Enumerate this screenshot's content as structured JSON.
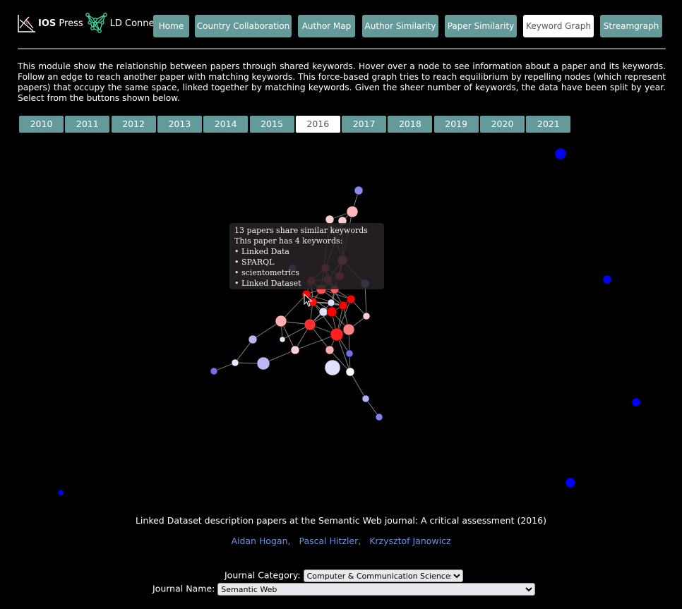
{
  "header": {
    "logo_ios": "IOS",
    "logo_press": " Press",
    "logo_ld": "LD Connect",
    "nav": [
      {
        "label": "Home",
        "active": false
      },
      {
        "label": "Country Collaboration",
        "active": false
      },
      {
        "label": "Author Map",
        "active": false
      },
      {
        "label": "Author Similarity",
        "active": false
      },
      {
        "label": "Paper Similarity",
        "active": false
      },
      {
        "label": "Keyword Graph",
        "active": true
      },
      {
        "label": "Streamgraph",
        "active": false
      }
    ]
  },
  "description": "This module show the relationship between papers through shared keywords. Hover over a node to see information about a paper and its keywords. Follow an edge to reach another paper with matching keywords. This force-based graph tries to reach equilibrium by repelling nodes (which represent papers) that occupy the same space, linked together by matching keywords. Given the sheer number of keywords, the data have been split by year. Select from the buttons shown below.",
  "years": [
    "2010",
    "2011",
    "2012",
    "2013",
    "2014",
    "2015",
    "2016",
    "2017",
    "2018",
    "2019",
    "2020",
    "2021"
  ],
  "selected_year": "2016",
  "tooltip": {
    "line1": "13 papers share similar keywords",
    "line2": "This paper has 4 keywords:",
    "keywords": [
      "Linked Data",
      "SPARQL",
      "scientometrics",
      "Linked Dataset"
    ]
  },
  "paper": {
    "title": "Linked Dataset description papers at the Semantic Web journal: A critical assessment (2016)",
    "authors": [
      "Aidan Hogan,",
      "Pascal Hitzler,",
      "Krzysztof Janowicz"
    ]
  },
  "filters": {
    "category_label": "Journal Category:",
    "category_value": "Computer & Communication Sciences",
    "name_label": "Journal Name:",
    "name_value": "Semantic Web"
  },
  "colors": {
    "button": "#659a9a",
    "red": "#ff0000",
    "blue": "#0000ff",
    "link": "#6b8fe0"
  }
}
